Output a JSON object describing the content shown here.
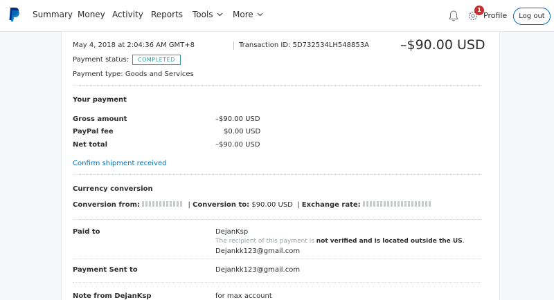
{
  "nav": {
    "items": [
      "Summary",
      "Money",
      "Activity",
      "Reports",
      "Tools",
      "More"
    ],
    "notification_count": "1",
    "profile_label": "Profile",
    "logout_label": "Log out",
    "brand_color": "#0070ba"
  },
  "transaction": {
    "date": "May 4, 2018 at 2:04:36 AM GMT+8",
    "transaction_id": "Transaction ID: 5D732534LH548853A",
    "amount": "–$90.00 USD",
    "status_label": "Payment status:",
    "status_value": "COMPLETED",
    "payment_type": "Payment type: Goods and Services"
  },
  "payment": {
    "heading": "Your payment",
    "rows": [
      {
        "label": "Gross amount",
        "value": "–$90.00 USD"
      },
      {
        "label": "PayPal fee",
        "value": "$0.00 USD"
      },
      {
        "label": "Net total",
        "value": "–$90.00 USD"
      }
    ],
    "confirm_link": "Confirm shipment received"
  },
  "conversion": {
    "heading": "Currency conversion",
    "from_label": "Conversion from:",
    "to_label": "Conversion to:",
    "to_value": "$90.00 USD",
    "rate_label": "Exchange rate:"
  },
  "paid_to": {
    "label": "Paid to",
    "name": "DejanKsp",
    "notice_prefix": "The recipient of this payment is ",
    "notice_bold": "not verified and is located outside the US",
    "notice_suffix": ".",
    "email": "Dejankk123@gmail.com"
  },
  "sent_to": {
    "label": "Payment Sent to",
    "email": "Dejankk123@gmail.com"
  },
  "note": {
    "label": "Note from DejanKsp",
    "value": "for max account"
  }
}
